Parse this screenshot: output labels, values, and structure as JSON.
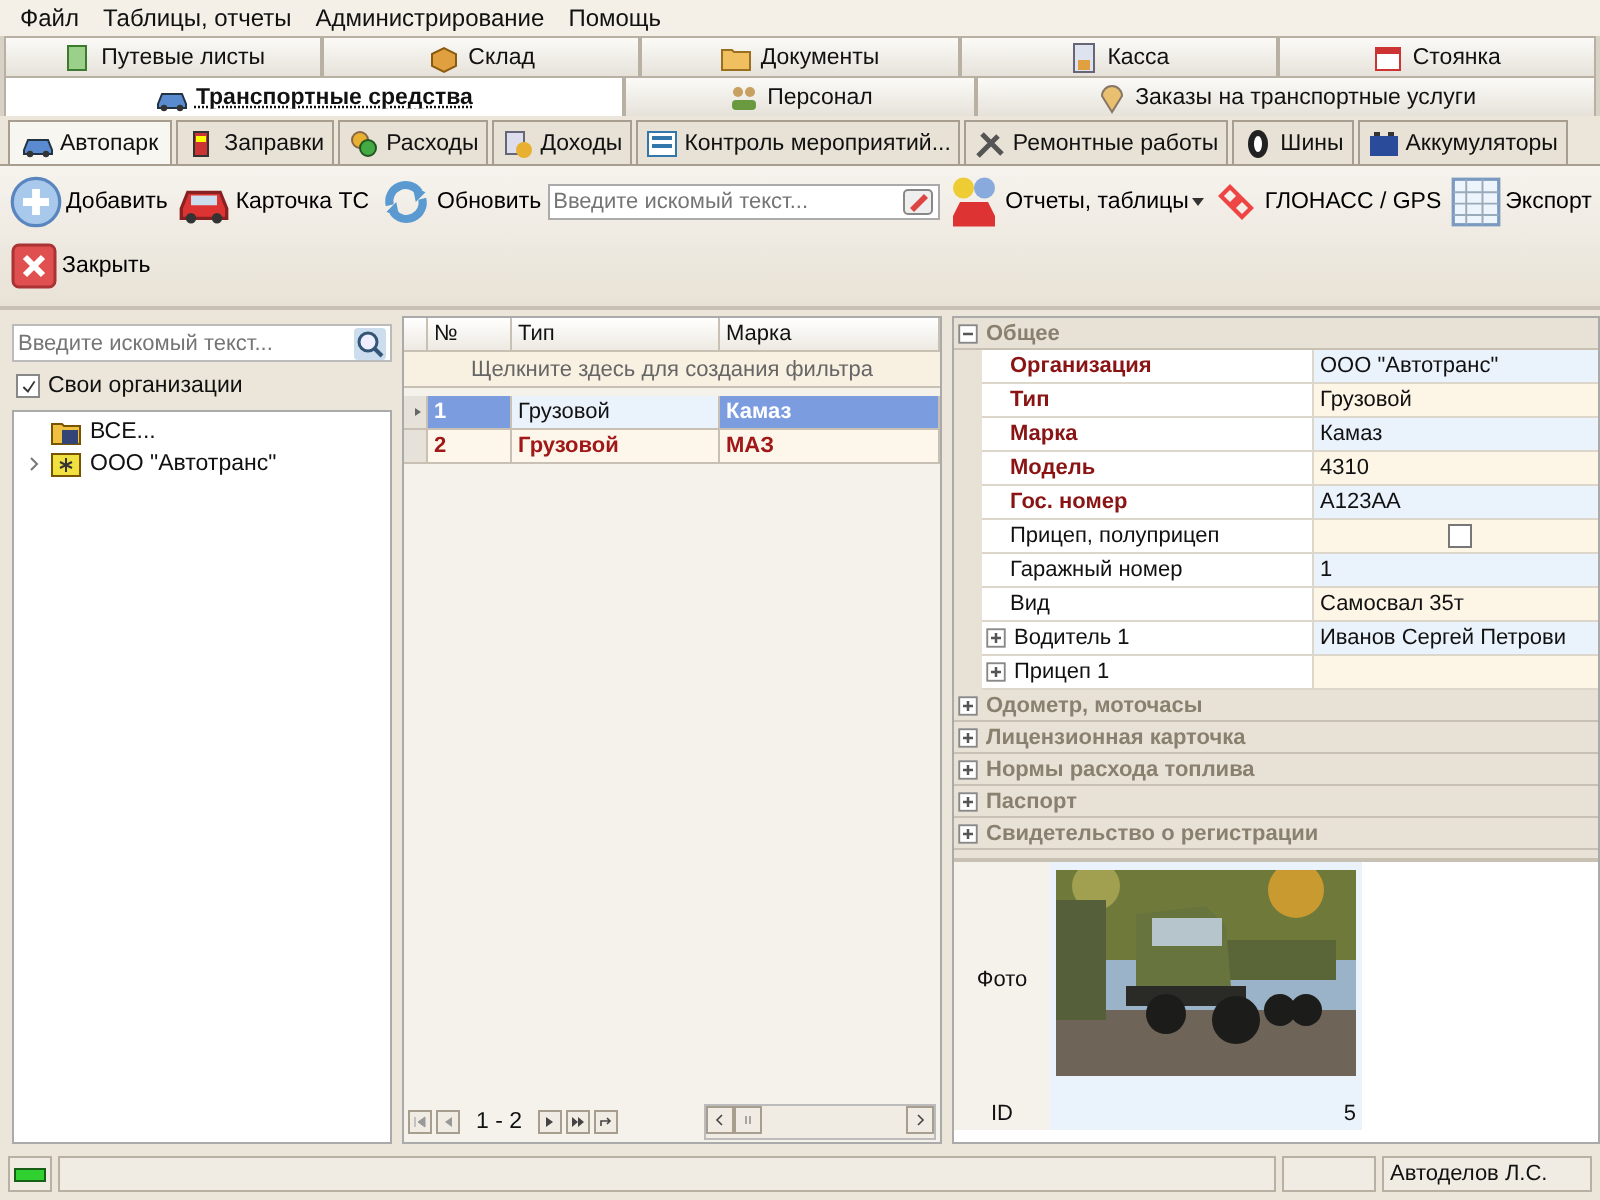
{
  "menu": [
    "Файл",
    "Таблицы, отчеты",
    "Администрирование",
    "Помощь"
  ],
  "module_tabs_top": [
    {
      "label": "Путевые листы",
      "selected": false
    },
    {
      "label": "Склад",
      "selected": false
    },
    {
      "label": "Документы",
      "selected": false
    },
    {
      "label": "Касса",
      "selected": false
    },
    {
      "label": "Стоянка",
      "selected": false
    }
  ],
  "module_tabs": [
    {
      "label": "Транспортные средства",
      "selected": true
    },
    {
      "label": "Персонал",
      "selected": false
    },
    {
      "label": "Заказы на транспортные услуги",
      "selected": false
    }
  ],
  "sub_tabs": [
    {
      "label": "Автопарк",
      "selected": true
    },
    {
      "label": "Заправки",
      "selected": false
    },
    {
      "label": "Расходы",
      "selected": false
    },
    {
      "label": "Доходы",
      "selected": false
    },
    {
      "label": "Контроль мероприятий...",
      "selected": false
    },
    {
      "label": "Ремонтные работы",
      "selected": false
    },
    {
      "label": "Шины",
      "selected": false
    },
    {
      "label": "Аккумуляторы",
      "selected": false
    }
  ],
  "toolbar": [
    {
      "kind": "button",
      "label": "Добавить"
    },
    {
      "kind": "button",
      "label": "Карточка ТС"
    },
    {
      "kind": "button",
      "label": "Обновить"
    },
    {
      "kind": "search",
      "placeholder": "Введите искомый текст..."
    },
    {
      "kind": "dropdown",
      "label": "Отчеты, таблицы"
    },
    {
      "kind": "button",
      "label": "ГЛОНАСС / GPS"
    },
    {
      "kind": "button",
      "label": "Экспорт"
    },
    {
      "kind": "button",
      "label": "Закрыть"
    }
  ],
  "tree": {
    "search": {
      "placeholder": "Введите искомый текст..."
    },
    "own_orgs": {
      "label": "Свои организации",
      "checked": true
    },
    "items": [
      {
        "kind": "all",
        "label": "ВСЕ..."
      },
      {
        "kind": "org",
        "label": "ООО \"Автотранс\"",
        "expanded": false
      }
    ]
  },
  "grid": {
    "columns": [
      "№",
      "Тип",
      "Марка"
    ],
    "filter_hint": "Щелкните здесь для создания фильтра",
    "rows": [
      {
        "cells": [
          "1",
          "Грузовой",
          "Камаз"
        ],
        "selected": true,
        "flagged": false
      },
      {
        "cells": [
          "2",
          "Грузовой",
          "МАЗ"
        ],
        "selected": false,
        "flagged": true
      }
    ],
    "pager": "1 - 2"
  },
  "properties": {
    "groups": [
      {
        "title": "Общее",
        "expanded": true,
        "rows": [
          {
            "kind": "text",
            "label": "Организация",
            "value": "ООО \"Автотранс\"",
            "required": true
          },
          {
            "kind": "text",
            "label": "Тип",
            "value": "Грузовой",
            "required": true
          },
          {
            "kind": "text",
            "label": "Марка",
            "value": "Камаз",
            "required": true
          },
          {
            "kind": "text",
            "label": "Модель",
            "value": "4310",
            "required": true
          },
          {
            "kind": "text",
            "label": "Гос. номер",
            "value": "А123АА",
            "required": true
          },
          {
            "kind": "checkbox",
            "label": "Прицеп, полуприцеп",
            "checked": false,
            "required": false
          },
          {
            "kind": "text",
            "label": "Гаражный номер",
            "value": "1",
            "required": false
          },
          {
            "kind": "text",
            "label": "Вид",
            "value": "Самосвал 35т",
            "required": false
          },
          {
            "kind": "expandable",
            "label": "Водитель 1",
            "value": "Иванов Сергей Петрови",
            "required": false,
            "expanded": false
          },
          {
            "kind": "expandable",
            "label": "Прицеп 1",
            "required": false,
            "expanded": false
          }
        ]
      },
      {
        "title": "Одометр, моточасы",
        "expanded": false
      },
      {
        "title": "Лицензионная карточка",
        "expanded": false
      },
      {
        "title": "Нормы расхода топлива",
        "expanded": false
      },
      {
        "title": "Паспорт",
        "expanded": false
      },
      {
        "title": "Свидетельство о регистрации",
        "expanded": false
      }
    ],
    "photo_label": "Фото",
    "id_label": "ID",
    "id_value": "5"
  },
  "status_bar": {
    "connected": true,
    "user": "Автоделов Л.С."
  }
}
